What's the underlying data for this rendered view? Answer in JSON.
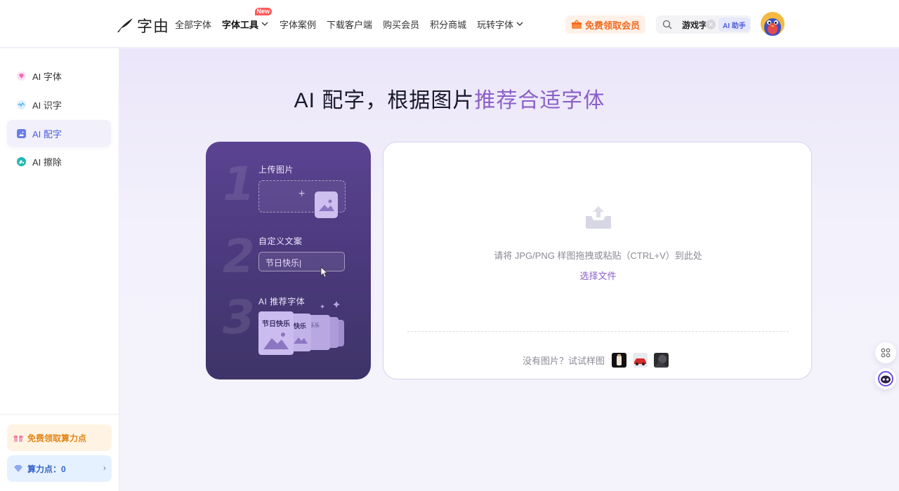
{
  "header": {
    "logo_text": "字由",
    "nav": [
      {
        "label": "全部字体"
      },
      {
        "label": "字体工具",
        "badge": "New"
      },
      {
        "label": "字体案例"
      },
      {
        "label": "下载客户端"
      },
      {
        "label": "购买会员"
      },
      {
        "label": "积分商城"
      },
      {
        "label": "玩转字体"
      }
    ],
    "vip_button": "免费领取会员",
    "search_value": "游戏字",
    "ai_helper": "AI 助手"
  },
  "sidebar": {
    "items": [
      {
        "label": "AI 字体",
        "color": "#f06bb5"
      },
      {
        "label": "AI 识字",
        "color": "#3aa8f0"
      },
      {
        "label": "AI 配字",
        "color": "#6a7ce8"
      },
      {
        "label": "AI 擦除",
        "color": "#20b8b0"
      }
    ],
    "active_index": 2,
    "free_points": "免费领取算力点",
    "points_label": "算力点：0"
  },
  "main": {
    "title_plain": "AI 配字，根据图片",
    "title_highlight": "推荐合适字体",
    "steps": [
      {
        "num": "1",
        "label": "上传图片"
      },
      {
        "num": "2",
        "label": "自定义文案"
      },
      {
        "num": "3",
        "label": "AI 推荐字体"
      }
    ],
    "upload_plus": "+",
    "sample_text": "节日快乐|",
    "font_card_text": "节日快乐",
    "font_card_small": [
      "快乐",
      "乐乐",
      "乐乐",
      "乐"
    ],
    "drop_text": "请将 JPG/PNG 样图拖拽或粘贴（CTRL+V）到此处",
    "select_file": "选择文件",
    "no_image_text": "没有图片？试试样图"
  },
  "colors": {
    "accent": "#8b5fc8",
    "orange": "#f06b22",
    "blue": "#4b5ce0"
  }
}
